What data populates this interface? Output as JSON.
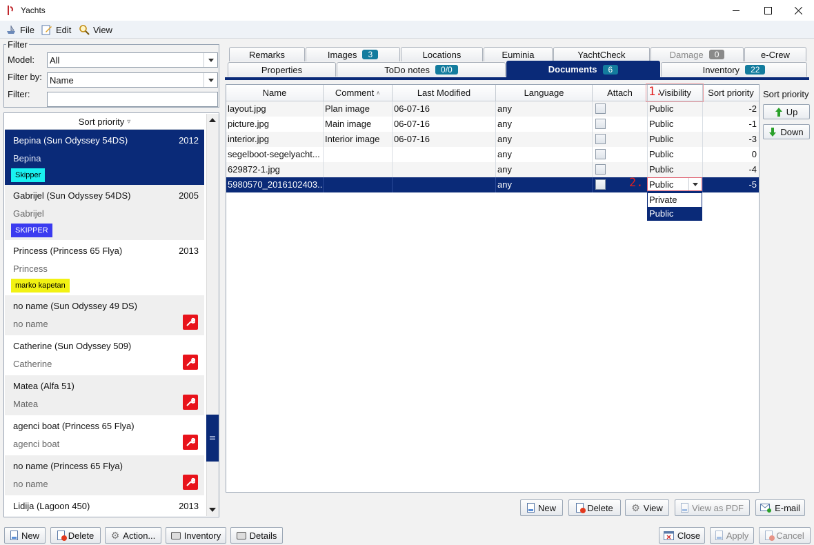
{
  "window": {
    "title": "Yachts"
  },
  "menu": [
    "File",
    "Edit",
    "View"
  ],
  "filter": {
    "legend": "Filter",
    "model_label": "Model:",
    "model_value": "All",
    "filterby_label": "Filter by:",
    "filterby_value": "Name",
    "filter_label": "Filter:",
    "filter_value": ""
  },
  "yacht_list": {
    "header": "Sort priority",
    "items": [
      {
        "name": "Bepina (Sun Odyssey 54DS)",
        "year": "2012",
        "sub": "Bepina",
        "tag": "Skipper",
        "tag_color": "#19f0f0",
        "tag_text_color": "#000000",
        "selected": true
      },
      {
        "name": "Gabrijel (Sun Odyssey 54DS)",
        "year": "2005",
        "sub": "Gabrijel",
        "tag": "SKIPPER",
        "tag_color": "#3b3bf0",
        "tag_text_color": "#ffffff"
      },
      {
        "name": "Princess (Princess 65 Flya)",
        "year": "2013",
        "sub": "Princess",
        "tag": "marko kapetan",
        "tag_color": "#f2f213",
        "tag_text_color": "#000000"
      },
      {
        "name": "no name (Sun Odyssey 49 DS)",
        "year": "",
        "sub": "no name",
        "icon": "wrench-icon"
      },
      {
        "name": "Catherine (Sun Odyssey 509)",
        "year": "",
        "sub": "Catherine",
        "icon": "wrench-icon"
      },
      {
        "name": "Matea (Alfa 51)",
        "year": "",
        "sub": "Matea",
        "icon": "wrench-icon"
      },
      {
        "name": "agenci boat (Princess 65 Flya)",
        "year": "",
        "sub": "agenci boat",
        "icon": "wrench-icon"
      },
      {
        "name": "no name (Princess 65 Flya)",
        "year": "",
        "sub": "no name",
        "icon": "wrench-icon"
      },
      {
        "name": "Lidija (Lagoon 450)",
        "year": "2013",
        "sub": ""
      }
    ]
  },
  "tabs_row1": [
    {
      "label": "Remarks"
    },
    {
      "label": "Images",
      "badge": "3"
    },
    {
      "label": "Locations"
    },
    {
      "label": "Euminia"
    },
    {
      "label": "YachtCheck"
    },
    {
      "label": "Damage",
      "badge": "0",
      "disabled": true
    },
    {
      "label": "e-Crew"
    }
  ],
  "tabs_row2": [
    {
      "label": "Properties"
    },
    {
      "label": "ToDo notes",
      "badge": "0/0"
    },
    {
      "label": "Documents",
      "badge": "6",
      "active": true
    },
    {
      "label": "Inventory",
      "badge": "22"
    }
  ],
  "documents": {
    "columns": [
      "Name",
      "Comment",
      "Last Modified",
      "Language",
      "Attach",
      "Visibility",
      "Sort priority"
    ],
    "comment_sort_glyph": "∧",
    "rows": [
      {
        "name": "layout.jpg",
        "comment": "Plan image",
        "modified": "06-07-16",
        "language": "any",
        "visibility": "Public",
        "sort": "-2"
      },
      {
        "name": "picture.jpg",
        "comment": "Main image",
        "modified": "06-07-16",
        "language": "any",
        "visibility": "Public",
        "sort": "-1"
      },
      {
        "name": "interior.jpg",
        "comment": "Interior image",
        "modified": "06-07-16",
        "language": "any",
        "visibility": "Public",
        "sort": "-3"
      },
      {
        "name": "segelboot-segelyacht...",
        "comment": "",
        "modified": "",
        "language": "any",
        "visibility": "Public",
        "sort": "0"
      },
      {
        "name": "629872-1.jpg",
        "comment": "",
        "modified": "",
        "language": "any",
        "visibility": "Public",
        "sort": "-4"
      },
      {
        "name": "5980570_2016102403...",
        "comment": "",
        "modified": "",
        "language": "any",
        "visibility": "Public",
        "sort": "-5",
        "selected": true
      }
    ],
    "visibility_options": [
      "Private",
      "Public"
    ],
    "marker1": "1.",
    "marker2": "2."
  },
  "sort_priority": {
    "label": "Sort priority",
    "up": "Up",
    "down": "Down"
  },
  "doc_buttons": {
    "new": "New",
    "delete": "Delete",
    "view": "View",
    "view_pdf": "View as PDF",
    "email": "E-mail"
  },
  "bottom_buttons": {
    "new": "New",
    "delete": "Delete",
    "action": "Action...",
    "inventory": "Inventory",
    "details": "Details",
    "close": "Close",
    "apply": "Apply",
    "cancel": "Cancel"
  },
  "colors": {
    "accent": "#0a2a78",
    "badge": "#137c9e",
    "wrench": "#e8131b",
    "marker": "#e02020"
  }
}
